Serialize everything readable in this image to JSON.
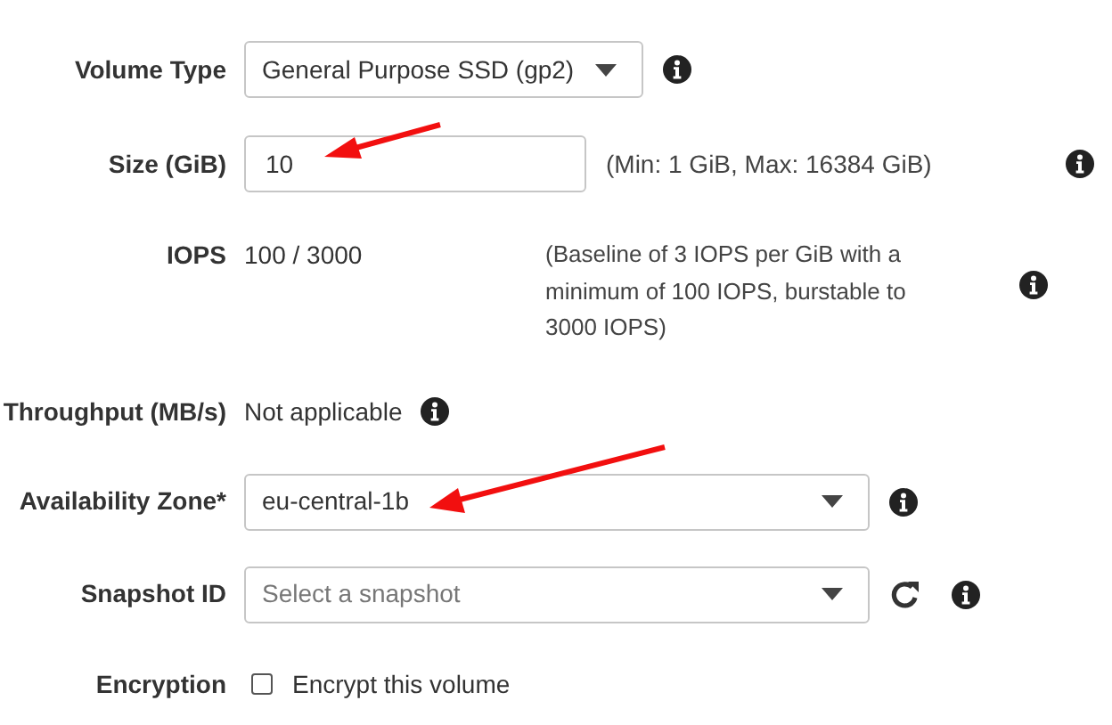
{
  "fields": [
    {
      "kind": "select",
      "label": "Volume Type",
      "value": "General Purpose SSD (gp2)",
      "wide": false,
      "info": true
    },
    {
      "kind": "input",
      "label": "Size (GiB)",
      "value": "10",
      "hint": "(Min: 1 GiB, Max: 16384 GiB)",
      "info": true
    },
    {
      "kind": "text",
      "label": "IOPS",
      "value": "100 / 3000",
      "hint": "(Baseline of 3 IOPS per GiB with a minimum of 100 IOPS, burstable to 3000 IOPS)",
      "info": true
    },
    {
      "kind": "text",
      "label": "Throughput (MB/s)",
      "value": "Not applicable",
      "info": true
    },
    {
      "kind": "select",
      "label": "Availability Zone*",
      "value": "eu-central-1b",
      "wide": true,
      "info": true
    },
    {
      "kind": "select",
      "label": "Snapshot ID",
      "placeholder": "Select a snapshot",
      "wide": true,
      "refresh": true,
      "info": true
    },
    {
      "kind": "checkbox",
      "label": "Encryption",
      "option": "Encrypt this volume",
      "checked": false
    }
  ]
}
